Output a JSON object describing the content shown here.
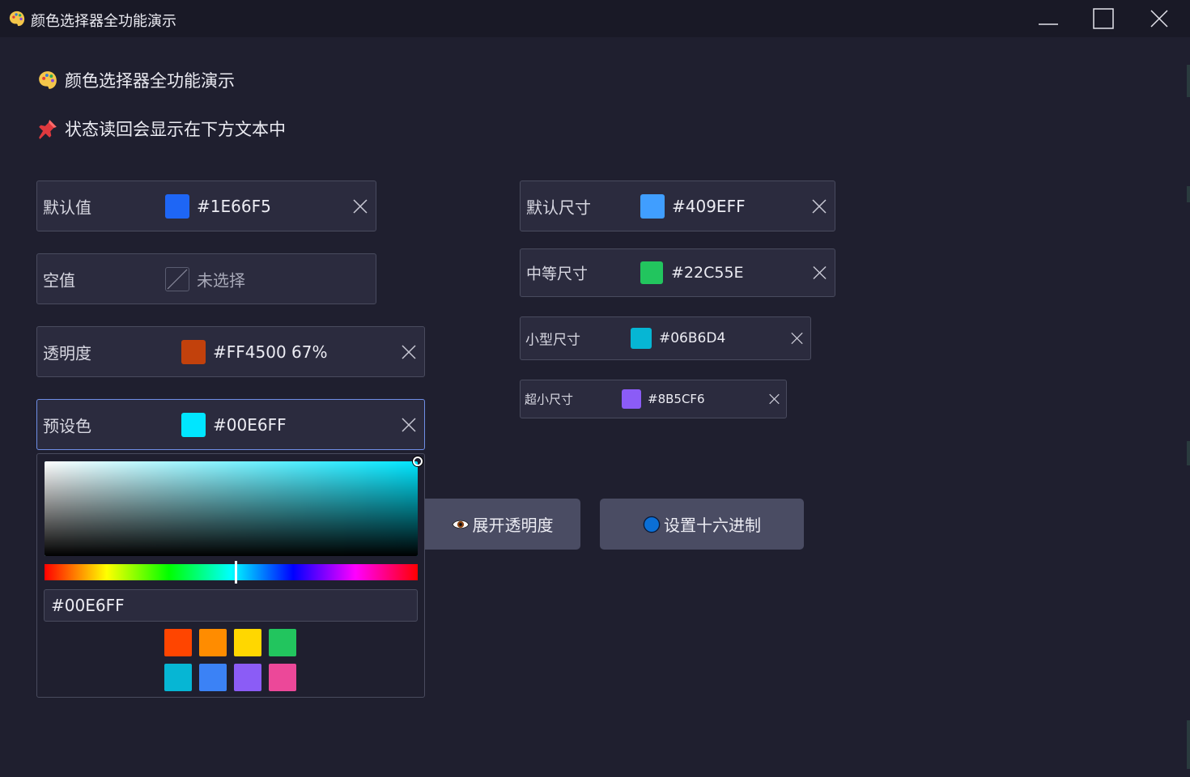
{
  "window": {
    "title": "颜色选择器全功能演示",
    "icon": "palette-icon",
    "controls": [
      "minimize-icon",
      "maximize-icon",
      "close-icon"
    ]
  },
  "headings": {
    "title": "颜色选择器全功能演示",
    "subtitle": "状态读回会显示在下方文本中"
  },
  "pickers_left": [
    {
      "label": "默认值",
      "value": "#1E66F5",
      "color": "#1E66F5"
    },
    {
      "label": "空值",
      "value": "未选择",
      "color": null
    },
    {
      "label": "透明度",
      "value": "#FF4500 67%",
      "color": "#C2410C"
    },
    {
      "label": "预设色",
      "value": "#00E6FF",
      "color": "#00E6FF"
    }
  ],
  "pickers_right": [
    {
      "label": "默认尺寸",
      "value": "#409EFF",
      "color": "#409EFF"
    },
    {
      "label": "中等尺寸",
      "value": "#22C55E",
      "color": "#22C55E"
    },
    {
      "label": "小型尺寸",
      "value": "#06B6D4",
      "color": "#06B6D4"
    },
    {
      "label": "超小尺寸",
      "value": "#8B5CF6",
      "color": "#8B5CF6"
    }
  ],
  "buttons": {
    "toggle_alpha": "展开透明度",
    "set_hex": "设置十六进制"
  },
  "popup": {
    "hue_color": "#00E6FF",
    "hex_value": "#00E6FF",
    "presets": [
      "#FF4500",
      "#FF8C00",
      "#FFD700",
      "#22C55E",
      "#06B6D4",
      "#3B82F6",
      "#8B5CF6",
      "#EC4899"
    ]
  }
}
